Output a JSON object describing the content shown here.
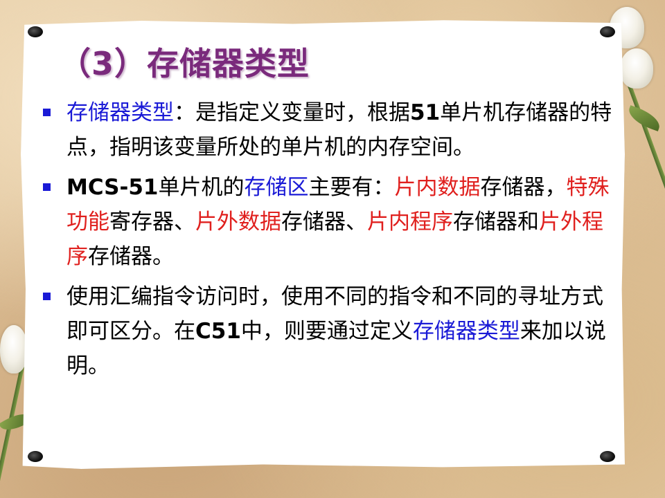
{
  "title": "（3）存储器类型",
  "colors": {
    "title": "#7a2a7c",
    "highlight_blue": "#1a1ad6",
    "highlight_red": "#e0201e",
    "body_text": "#000000"
  },
  "bullets": [
    {
      "segments": [
        {
          "text": "存储器类型",
          "style": "blue"
        },
        {
          "text": "：是指定义变量时，根据",
          "style": "normal"
        },
        {
          "text": "51",
          "style": "bold"
        },
        {
          "text": "单片机存储器的特点，指明该变量所处的单片机的内存空间。",
          "style": "normal"
        }
      ]
    },
    {
      "segments": [
        {
          "text": "MCS-51",
          "style": "bold"
        },
        {
          "text": "单片机的",
          "style": "normal"
        },
        {
          "text": "存储区",
          "style": "blue"
        },
        {
          "text": "主要有：",
          "style": "normal"
        },
        {
          "text": "片内数据",
          "style": "red"
        },
        {
          "text": "存储器，",
          "style": "normal"
        },
        {
          "text": "特殊功能",
          "style": "red"
        },
        {
          "text": "寄存器、",
          "style": "normal"
        },
        {
          "text": "片外数据",
          "style": "red"
        },
        {
          "text": "存储器、",
          "style": "normal"
        },
        {
          "text": "片内程序",
          "style": "red"
        },
        {
          "text": "存储器和",
          "style": "normal"
        },
        {
          "text": "片外程序",
          "style": "red"
        },
        {
          "text": "存储器。",
          "style": "normal"
        }
      ]
    },
    {
      "segments": [
        {
          "text": "使用汇编指令访问时，使用不同的指令和不同的寻址方式即可区分。在",
          "style": "normal"
        },
        {
          "text": "C51",
          "style": "bold"
        },
        {
          "text": "中，则要通过定义",
          "style": "normal"
        },
        {
          "text": "存储器类型",
          "style": "blue"
        },
        {
          "text": "来加以说明。",
          "style": "normal"
        }
      ]
    }
  ]
}
